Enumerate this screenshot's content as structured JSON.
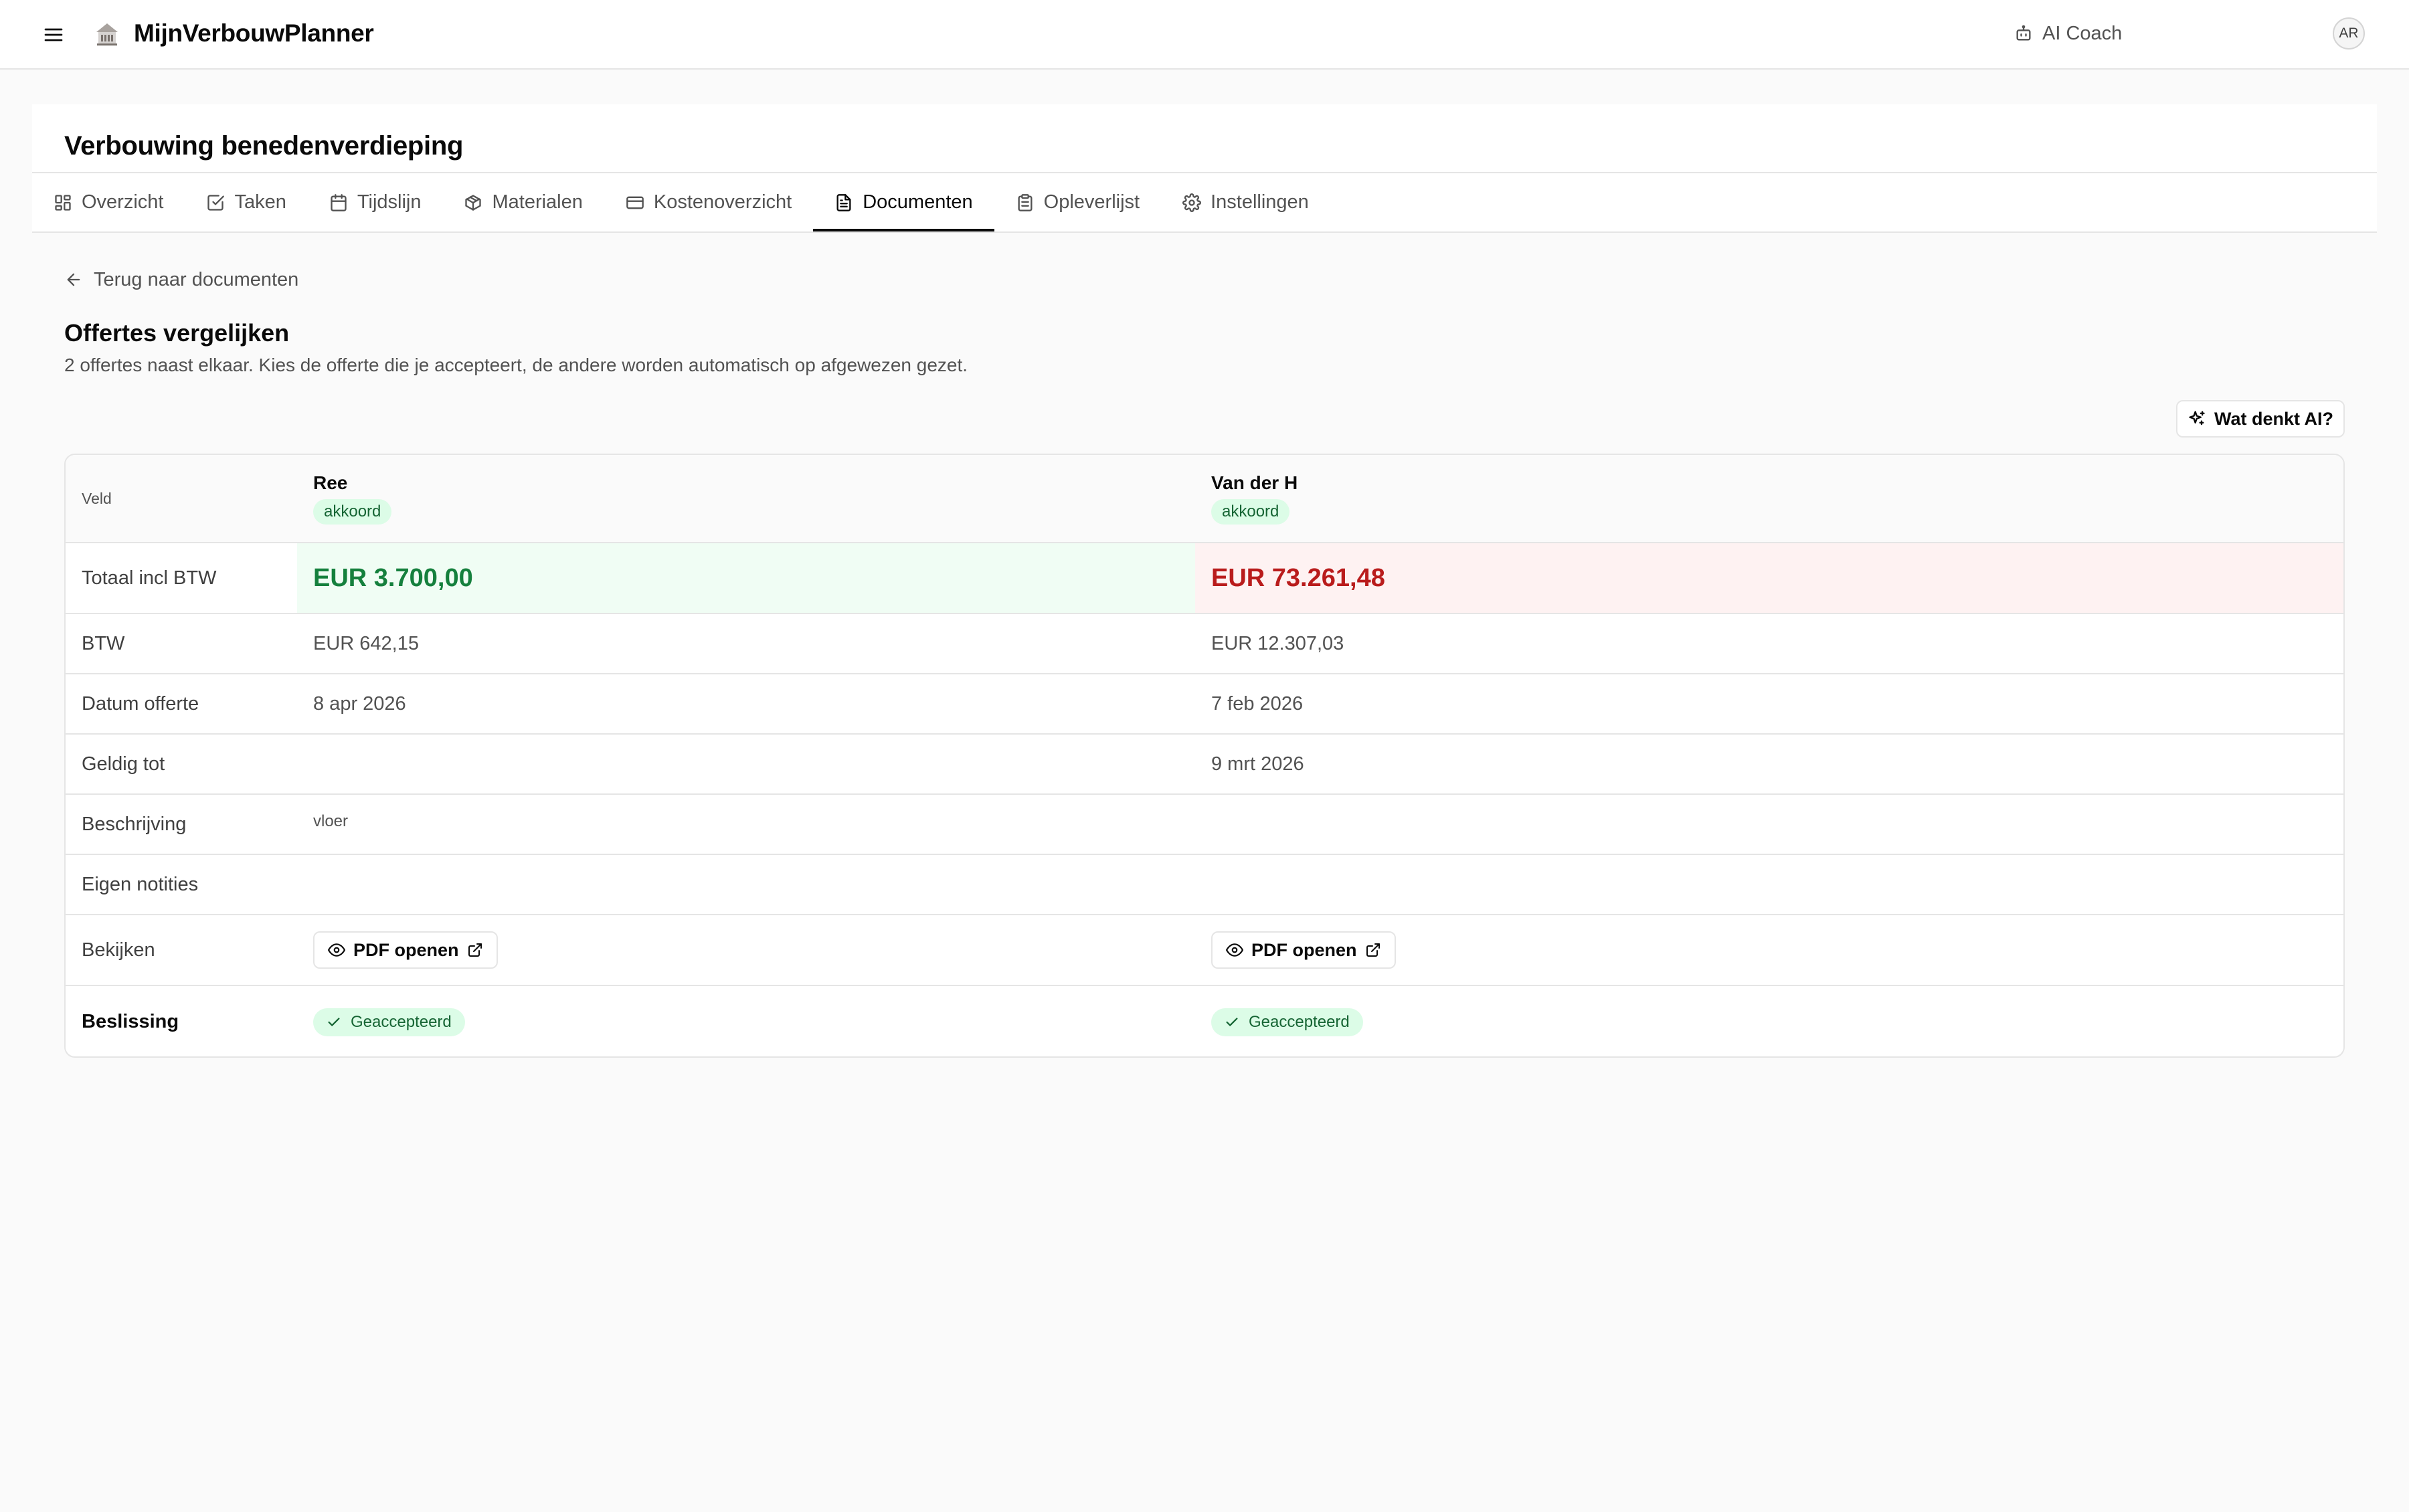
{
  "app": {
    "title": "MijnVerbouwPlanner",
    "ai_coach_label": "AI Coach",
    "user_initials": "AR"
  },
  "project": {
    "title": "Verbouwing benedenverdieping"
  },
  "tabs": [
    {
      "label": "Overzicht",
      "icon": "layout-grid-icon"
    },
    {
      "label": "Taken",
      "icon": "check-square-icon"
    },
    {
      "label": "Tijdslijn",
      "icon": "calendar-icon"
    },
    {
      "label": "Materialen",
      "icon": "package-icon"
    },
    {
      "label": "Kostenoverzicht",
      "icon": "credit-card-icon"
    },
    {
      "label": "Documenten",
      "icon": "file-text-icon",
      "active": true
    },
    {
      "label": "Opleverlijst",
      "icon": "clipboard-icon"
    },
    {
      "label": "Instellingen",
      "icon": "gear-icon"
    }
  ],
  "back_link": "Terug naar documenten",
  "page": {
    "title": "Offertes vergelijken",
    "subtitle": "2 offertes naast elkaar. Kies de offerte die je accepteert, de andere worden automatisch op afgewezen gezet."
  },
  "ai_button": "Wat denkt AI?",
  "table": {
    "field_header": "Veld",
    "quotes": [
      {
        "supplier": "Ree",
        "status": "akkoord",
        "total": "EUR 3.700,00",
        "btw": "EUR 642,15",
        "datum": "8 apr 2026",
        "geldig": "",
        "beschrijving": "vloer",
        "notities": "",
        "pdf_label": "PDF openen",
        "decision": "Geaccepteerd"
      },
      {
        "supplier": "Van der H",
        "status": "akkoord",
        "total": "EUR 73.261,48",
        "btw": "EUR 12.307,03",
        "datum": "7 feb 2026",
        "geldig": "9 mrt 2026",
        "beschrijving": "",
        "notities": "",
        "pdf_label": "PDF openen",
        "decision": "Geaccepteerd"
      }
    ],
    "row_labels": {
      "total": "Totaal incl BTW",
      "btw": "BTW",
      "datum": "Datum offerte",
      "geldig": "Geldig tot",
      "beschrijving": "Beschrijving",
      "notities": "Eigen notities",
      "bekijken": "Bekijken",
      "beslissing": "Beslissing"
    }
  },
  "colors": {
    "accent": "#0a0a0a",
    "lowest_total": "#15803d",
    "highest_total": "#b91c1c",
    "badge_bg": "#dcfce7",
    "badge_text": "#166534"
  }
}
